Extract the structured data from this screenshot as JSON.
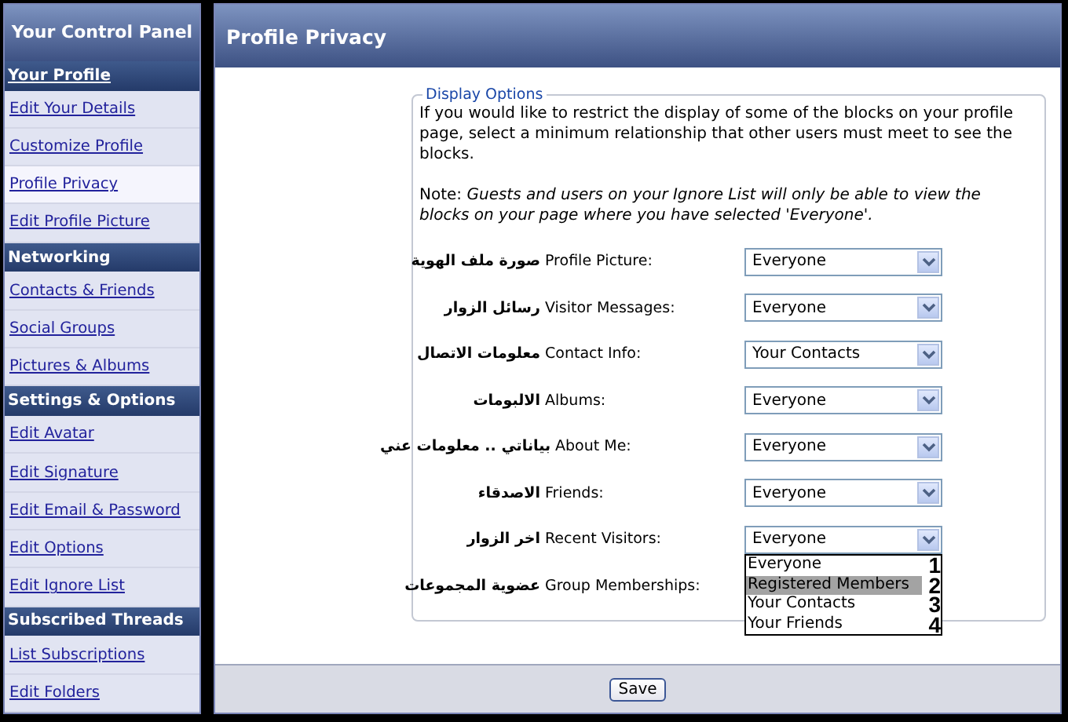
{
  "sidebar": {
    "title": "Your Control Panel",
    "sections": [
      {
        "heading": "Your Profile",
        "heading_link": true,
        "items": [
          {
            "label": "Edit Your Details",
            "selected": false
          },
          {
            "label": "Customize Profile",
            "selected": false
          },
          {
            "label": "Profile Privacy",
            "selected": true
          },
          {
            "label": "Edit Profile Picture",
            "selected": false
          }
        ]
      },
      {
        "heading": "Networking",
        "heading_link": false,
        "items": [
          {
            "label": "Contacts & Friends",
            "selected": false
          },
          {
            "label": "Social Groups",
            "selected": false
          },
          {
            "label": "Pictures & Albums",
            "selected": false
          }
        ]
      },
      {
        "heading": "Settings & Options",
        "heading_link": false,
        "items": [
          {
            "label": "Edit Avatar",
            "selected": false
          },
          {
            "label": "Edit Signature",
            "selected": false
          },
          {
            "label": "Edit Email & Password",
            "selected": false
          },
          {
            "label": "Edit Options",
            "selected": false
          },
          {
            "label": "Edit Ignore List",
            "selected": false
          }
        ]
      },
      {
        "heading": "Subscribed Threads",
        "heading_link": false,
        "items": [
          {
            "label": "List Subscriptions",
            "selected": false
          },
          {
            "label": "Edit Folders",
            "selected": false
          }
        ]
      }
    ]
  },
  "main": {
    "title": "Profile Privacy",
    "fieldset": {
      "legend": "Display Options",
      "intro": "If you would like to restrict the display of some of the blocks on your profile page, select a minimum relationship that other users must meet to see the blocks.",
      "note": "Note: *Guests and users on your Ignore List will only be able to view the blocks on your page where you have selected 'Everyone'.*",
      "rows": [
        {
          "arabic": "صورة ملف الهوية",
          "label": "Profile Picture:",
          "value": "Everyone"
        },
        {
          "arabic": "رسائل الزوار",
          "label": "Visitor Messages:",
          "value": "Everyone"
        },
        {
          "arabic": "معلومات الاتصال",
          "label": "Contact Info:",
          "value": "Your Contacts"
        },
        {
          "arabic": "الالبومات",
          "label": "Albums:",
          "value": "Everyone"
        },
        {
          "arabic": "بياناتي .. معلومات عني",
          "label": "About Me:",
          "value": "Everyone"
        },
        {
          "arabic": "الاصدقاء",
          "label": "Friends:",
          "value": "Everyone"
        },
        {
          "arabic": "اخر الزوار",
          "label": "Recent Visitors:",
          "value": "Everyone",
          "expanded": true,
          "options": [
            {
              "label": "Everyone",
              "highlighted": false,
              "number": "1"
            },
            {
              "label": "Registered Members",
              "highlighted": true,
              "number": "2"
            },
            {
              "label": "Your Contacts",
              "highlighted": false,
              "number": "3"
            },
            {
              "label": "Your Friends",
              "highlighted": false,
              "number": "4"
            }
          ]
        },
        {
          "arabic": "عضوية المجموعات",
          "label": "Group Memberships:"
        }
      ]
    },
    "save_button": "Save"
  }
}
